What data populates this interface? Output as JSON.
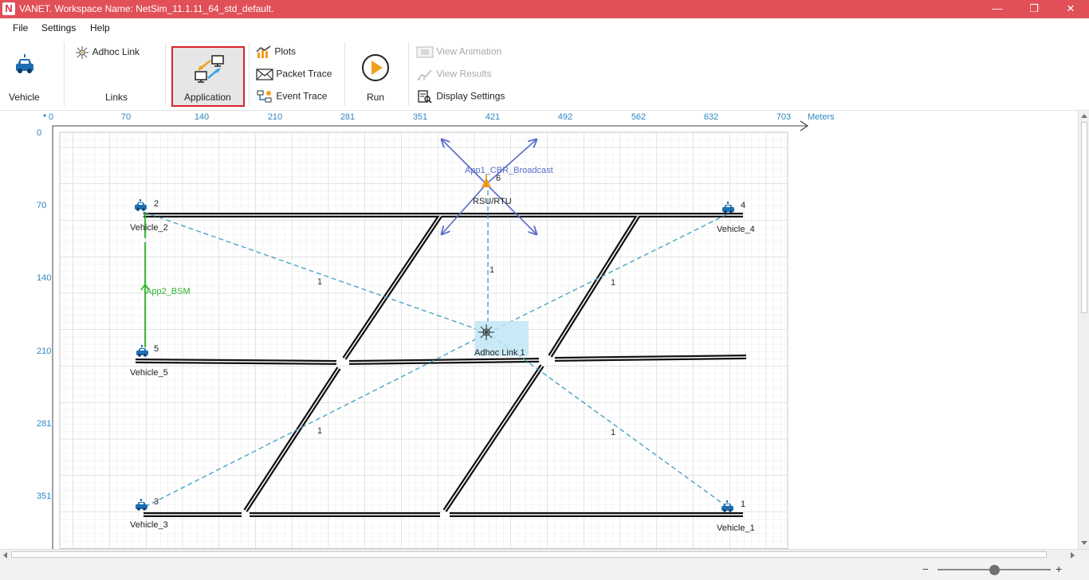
{
  "window": {
    "logo_letter": "N",
    "title": "VANET. Workspace Name: NetSim_11.1.11_64_std_default.",
    "minimize_glyph": "—",
    "restore_glyph": "❐",
    "close_glyph": "✕"
  },
  "menu": {
    "file": "File",
    "settings": "Settings",
    "help": "Help"
  },
  "ribbon": {
    "vehicle": "Vehicle",
    "adhoc_link": "Adhoc Link",
    "links_group": "Links",
    "application": "Application",
    "plots": "Plots",
    "packet_trace": "Packet Trace",
    "event_trace": "Event Trace",
    "run": "Run",
    "view_animation": "View Animation",
    "view_results": "View Results",
    "display_settings": "Display Settings"
  },
  "axes": {
    "x_ticks": [
      "0",
      "70",
      "140",
      "210",
      "281",
      "351",
      "421",
      "492",
      "562",
      "632",
      "703"
    ],
    "x_unit": "Meters",
    "y_ticks": [
      "0",
      "70",
      "140",
      "210",
      "281",
      "351"
    ]
  },
  "nodes": {
    "vehicle_1": {
      "label": "Vehicle_1",
      "id": "1"
    },
    "vehicle_2": {
      "label": "Vehicle_2",
      "id": "2"
    },
    "vehicle_3": {
      "label": "Vehicle_3",
      "id": "3"
    },
    "vehicle_4": {
      "label": "Vehicle_4",
      "id": "4"
    },
    "vehicle_5": {
      "label": "Vehicle_5",
      "id": "5"
    },
    "rsu": {
      "label": "RSU/RTU",
      "id": "6"
    },
    "adhoc_link": {
      "label": "Adhoc Link 1"
    }
  },
  "links": {
    "weight_label": "1"
  },
  "applications": {
    "app1": "App1_CBR_Broadcast",
    "app2": "App2_BSM"
  },
  "status": {
    "zoom_minus": "−",
    "zoom_plus": "+",
    "zoom_level": 0.5
  },
  "colors": {
    "titlebar": "#e14f57",
    "accent_blue": "#2e86c1",
    "link_dash": "#4aa3c3",
    "app1_arrow": "#5b6bc9",
    "app2_arrow": "#2ab52a",
    "highlight_red": "#d9252c"
  }
}
